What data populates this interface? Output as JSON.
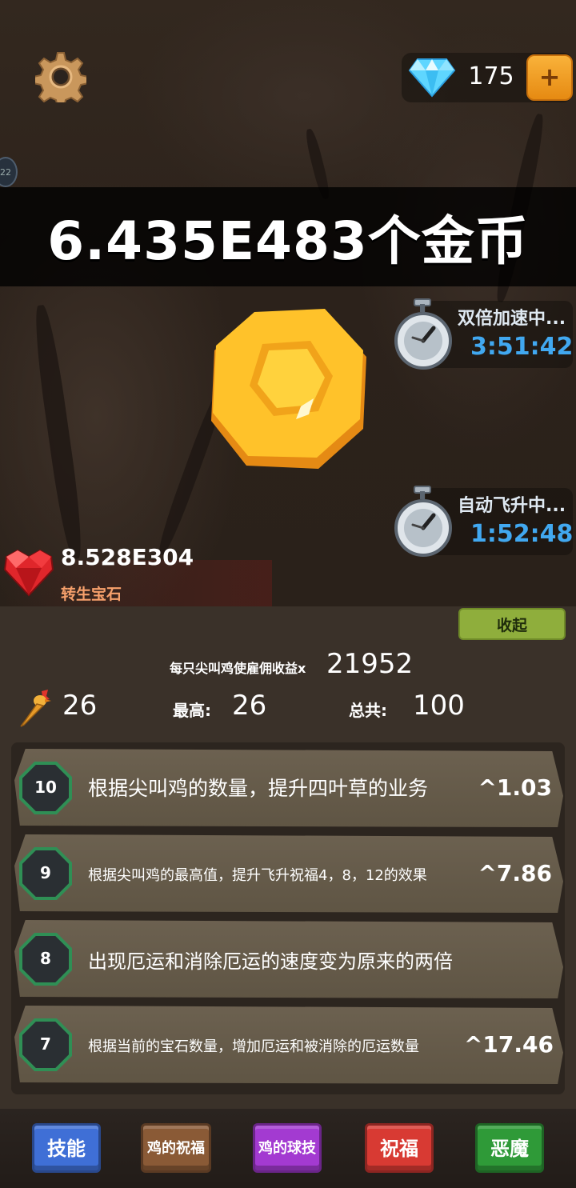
{
  "header": {
    "gem_count": "175",
    "plus_label": "+",
    "side_badge": "22"
  },
  "coins": {
    "banner_text": "6.435E483个金币"
  },
  "timers": [
    {
      "label": "双倍加速中...",
      "time": "3:51:42"
    },
    {
      "label": "自动飞升中...",
      "time": "1:52:48"
    }
  ],
  "rebirth": {
    "value": "8.528E304",
    "label": "转生宝石"
  },
  "panel": {
    "collapse_label": "收起",
    "multiplier_label": "每只尖叫鸡使雇佣收益x",
    "multiplier_value": "21952",
    "chicken_count": "26",
    "max_label": "最高:",
    "max_value": "26",
    "total_label": "总共:",
    "total_value": "100"
  },
  "skills": [
    {
      "level": "10",
      "text": "根据尖叫鸡的数量，提升四叶草的业务",
      "value": "^1.03"
    },
    {
      "level": "9",
      "text": "根据尖叫鸡的最高值，提升飞升祝福4，8，12的效果",
      "value": "^7.86"
    },
    {
      "level": "8",
      "text": "出现厄运和消除厄运的速度变为原来的两倍",
      "value": ""
    },
    {
      "level": "7",
      "text": "根据当前的宝石数量，增加厄运和被消除的厄运数量",
      "value": "^17.46"
    }
  ],
  "tabs": [
    {
      "label": "技能",
      "color": "#3f6fd6"
    },
    {
      "label": "鸡的祝福",
      "color": "#8a5a36"
    },
    {
      "label": "鸡的球技",
      "color": "#a33ad1"
    },
    {
      "label": "祝福",
      "color": "#d83a33"
    },
    {
      "label": "恶魔",
      "color": "#2f9a38"
    }
  ],
  "icons": {
    "settings": "gear-icon",
    "gem": "diamond-icon",
    "coin": "gold-coin-icon",
    "timer": "stopwatch-icon",
    "rebirth": "heart-gem-icon",
    "chicken": "rubber-chicken-icon"
  }
}
